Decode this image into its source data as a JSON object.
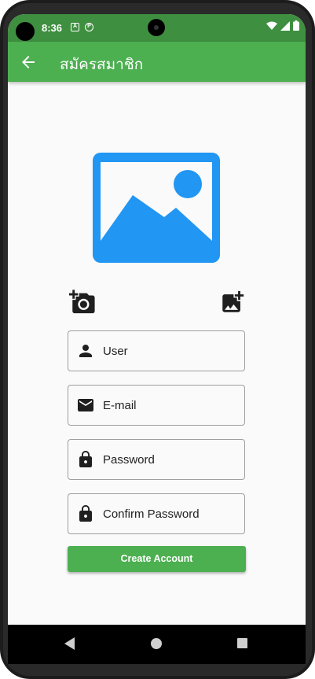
{
  "status_bar": {
    "time": "8:36",
    "notif_icons": [
      "A",
      "P"
    ]
  },
  "app_bar": {
    "title": "สมัครสมาชิก",
    "back_icon": "arrow-back-icon"
  },
  "profile_image": {
    "icon": "image-placeholder-icon",
    "color": "#2196f3"
  },
  "image_actions": {
    "camera_icon": "add-a-photo-icon",
    "gallery_icon": "add-photo-alternate-icon"
  },
  "form": {
    "fields": [
      {
        "icon": "person-icon",
        "label": "User"
      },
      {
        "icon": "mail-icon",
        "label": "E-mail"
      },
      {
        "icon": "lock-icon",
        "label": "Password"
      },
      {
        "icon": "lock-icon",
        "label": "Confirm Password"
      }
    ],
    "submit_label": "Create Account"
  },
  "colors": {
    "primary": "#4caf50",
    "status_bar": "#3f8f40",
    "image_blue": "#2196f3"
  }
}
